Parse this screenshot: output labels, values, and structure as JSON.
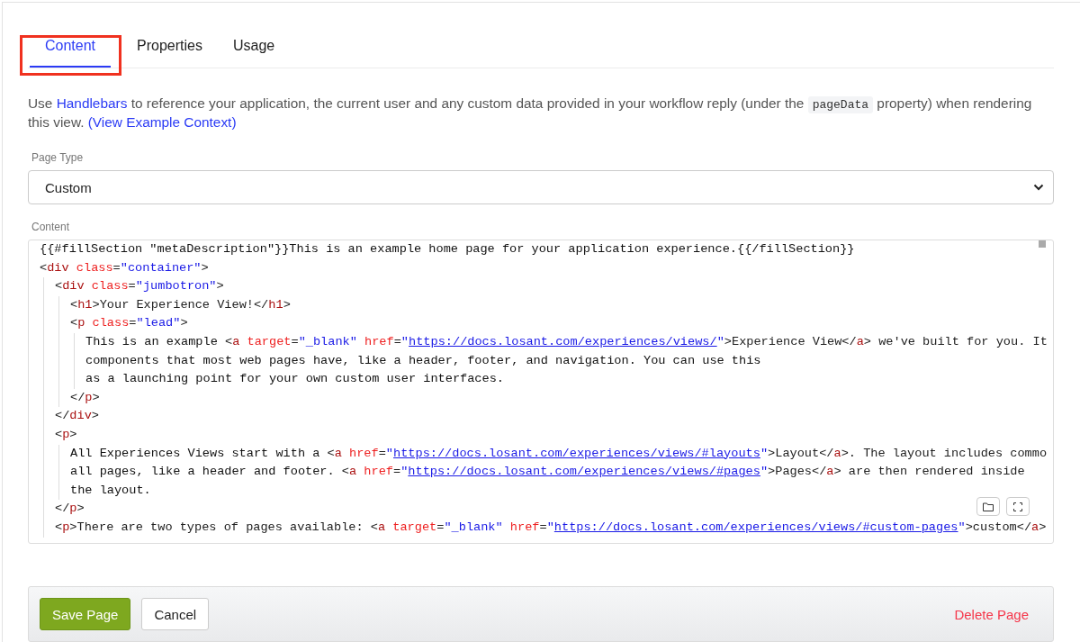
{
  "tabs": [
    {
      "label": "Content",
      "selected": true,
      "highlighted": true
    },
    {
      "label": "Properties",
      "selected": false,
      "highlighted": false
    },
    {
      "label": "Usage",
      "selected": false,
      "highlighted": false
    }
  ],
  "description": [
    {
      "kind": "text",
      "text": "Use "
    },
    {
      "kind": "link",
      "text": "Handlebars"
    },
    {
      "kind": "text",
      "text": " to reference your application, the current user and any custom data provided in your workflow reply (under the "
    },
    {
      "kind": "code",
      "text": "pageData"
    },
    {
      "kind": "text",
      "text": " property) when rendering this view. "
    },
    {
      "kind": "link",
      "text": "(View Example Context)"
    }
  ],
  "page_type": {
    "label": "Page Type",
    "value": "Custom"
  },
  "content": {
    "label": "Content",
    "lines": [
      {
        "segments": [
          {
            "kind": "x",
            "text": "{{#fillSection \"metaDescription\"}}This is an example home page for your application experience.{{/fillSection}}"
          }
        ]
      },
      {
        "segments": [
          {
            "kind": "p",
            "text": "<"
          },
          {
            "kind": "t",
            "text": "div"
          },
          {
            "kind": "a",
            "text": " class"
          },
          {
            "kind": "p",
            "text": "="
          },
          {
            "kind": "s",
            "text": "\"container\""
          },
          {
            "kind": "p",
            "text": ">"
          }
        ],
        "children": [
          {
            "segments": [
              {
                "kind": "p",
                "text": "<"
              },
              {
                "kind": "t",
                "text": "div"
              },
              {
                "kind": "a",
                "text": " class"
              },
              {
                "kind": "p",
                "text": "="
              },
              {
                "kind": "s",
                "text": "\"jumbotron\""
              },
              {
                "kind": "p",
                "text": ">"
              }
            ],
            "children": [
              {
                "segments": [
                  {
                    "kind": "p",
                    "text": "<"
                  },
                  {
                    "kind": "t",
                    "text": "h1"
                  },
                  {
                    "kind": "p",
                    "text": ">Your Experience View!</"
                  },
                  {
                    "kind": "t",
                    "text": "h1"
                  },
                  {
                    "kind": "p",
                    "text": ">"
                  }
                ]
              },
              {
                "segments": [
                  {
                    "kind": "p",
                    "text": "<"
                  },
                  {
                    "kind": "t",
                    "text": "p"
                  },
                  {
                    "kind": "a",
                    "text": " class"
                  },
                  {
                    "kind": "p",
                    "text": "="
                  },
                  {
                    "kind": "s",
                    "text": "\"lead\""
                  },
                  {
                    "kind": "p",
                    "text": ">"
                  }
                ],
                "children": [
                  {
                    "segments": [
                      {
                        "kind": "x",
                        "text": "This is an example "
                      },
                      {
                        "kind": "p",
                        "text": "<"
                      },
                      {
                        "kind": "t",
                        "text": "a"
                      },
                      {
                        "kind": "a",
                        "text": " target"
                      },
                      {
                        "kind": "p",
                        "text": "="
                      },
                      {
                        "kind": "s",
                        "text": "\"_blank\""
                      },
                      {
                        "kind": "a",
                        "text": " href"
                      },
                      {
                        "kind": "p",
                        "text": "="
                      },
                      {
                        "kind": "s",
                        "text": "\""
                      },
                      {
                        "kind": "u",
                        "text": "https://docs.losant.com/experiences/views/"
                      },
                      {
                        "kind": "s",
                        "text": "\""
                      },
                      {
                        "kind": "p",
                        "text": ">Experience View</"
                      },
                      {
                        "kind": "t",
                        "text": "a"
                      },
                      {
                        "kind": "p",
                        "text": "> we've built for you. It"
                      }
                    ]
                  },
                  {
                    "segments": [
                      {
                        "kind": "x",
                        "text": "components that most web pages have, like a header, footer, and navigation. You can use this"
                      }
                    ]
                  },
                  {
                    "segments": [
                      {
                        "kind": "x",
                        "text": "as a launching point for your own custom user interfaces."
                      }
                    ]
                  }
                ]
              },
              {
                "segments": [
                  {
                    "kind": "p",
                    "text": "</"
                  },
                  {
                    "kind": "t",
                    "text": "p"
                  },
                  {
                    "kind": "p",
                    "text": ">"
                  }
                ]
              }
            ]
          },
          {
            "segments": [
              {
                "kind": "p",
                "text": "</"
              },
              {
                "kind": "t",
                "text": "div"
              },
              {
                "kind": "p",
                "text": ">"
              }
            ]
          },
          {
            "segments": [
              {
                "kind": "p",
                "text": "<"
              },
              {
                "kind": "t",
                "text": "p"
              },
              {
                "kind": "p",
                "text": ">"
              }
            ],
            "children": [
              {
                "segments": [
                  {
                    "kind": "x",
                    "text": "All Experiences Views start with a "
                  },
                  {
                    "kind": "p",
                    "text": "<"
                  },
                  {
                    "kind": "t",
                    "text": "a"
                  },
                  {
                    "kind": "a",
                    "text": " href"
                  },
                  {
                    "kind": "p",
                    "text": "="
                  },
                  {
                    "kind": "s",
                    "text": "\""
                  },
                  {
                    "kind": "u",
                    "text": "https://docs.losant.com/experiences/views/#layouts"
                  },
                  {
                    "kind": "s",
                    "text": "\""
                  },
                  {
                    "kind": "p",
                    "text": ">Layout</"
                  },
                  {
                    "kind": "t",
                    "text": "a"
                  },
                  {
                    "kind": "p",
                    "text": ">. The layout includes commo"
                  }
                ]
              },
              {
                "segments": [
                  {
                    "kind": "x",
                    "text": "all pages, like a header and footer. "
                  },
                  {
                    "kind": "p",
                    "text": "<"
                  },
                  {
                    "kind": "t",
                    "text": "a"
                  },
                  {
                    "kind": "a",
                    "text": " href"
                  },
                  {
                    "kind": "p",
                    "text": "="
                  },
                  {
                    "kind": "s",
                    "text": "\""
                  },
                  {
                    "kind": "u",
                    "text": "https://docs.losant.com/experiences/views/#pages"
                  },
                  {
                    "kind": "s",
                    "text": "\""
                  },
                  {
                    "kind": "p",
                    "text": ">Pages</"
                  },
                  {
                    "kind": "t",
                    "text": "a"
                  },
                  {
                    "kind": "p",
                    "text": "> are then rendered inside"
                  }
                ]
              },
              {
                "segments": [
                  {
                    "kind": "x",
                    "text": "the layout."
                  }
                ]
              }
            ]
          },
          {
            "segments": [
              {
                "kind": "p",
                "text": "</"
              },
              {
                "kind": "t",
                "text": "p"
              },
              {
                "kind": "p",
                "text": ">"
              }
            ]
          },
          {
            "segments": [
              {
                "kind": "p",
                "text": "<"
              },
              {
                "kind": "t",
                "text": "p"
              },
              {
                "kind": "p",
                "text": ">There are two types of pages available: <"
              },
              {
                "kind": "t",
                "text": "a"
              },
              {
                "kind": "a",
                "text": " target"
              },
              {
                "kind": "p",
                "text": "="
              },
              {
                "kind": "s",
                "text": "\"_blank\""
              },
              {
                "kind": "a",
                "text": " href"
              },
              {
                "kind": "p",
                "text": "="
              },
              {
                "kind": "s",
                "text": "\""
              },
              {
                "kind": "u",
                "text": "https://docs.losant.com/experiences/views/#custom-pages"
              },
              {
                "kind": "s",
                "text": "\""
              },
              {
                "kind": "p",
                "text": ">custom</"
              },
              {
                "kind": "t",
                "text": "a"
              },
              {
                "kind": "p",
                "text": ">"
              }
            ]
          }
        ]
      }
    ]
  },
  "actions": {
    "save": "Save Page",
    "cancel": "Cancel",
    "delete": "Delete Page"
  }
}
